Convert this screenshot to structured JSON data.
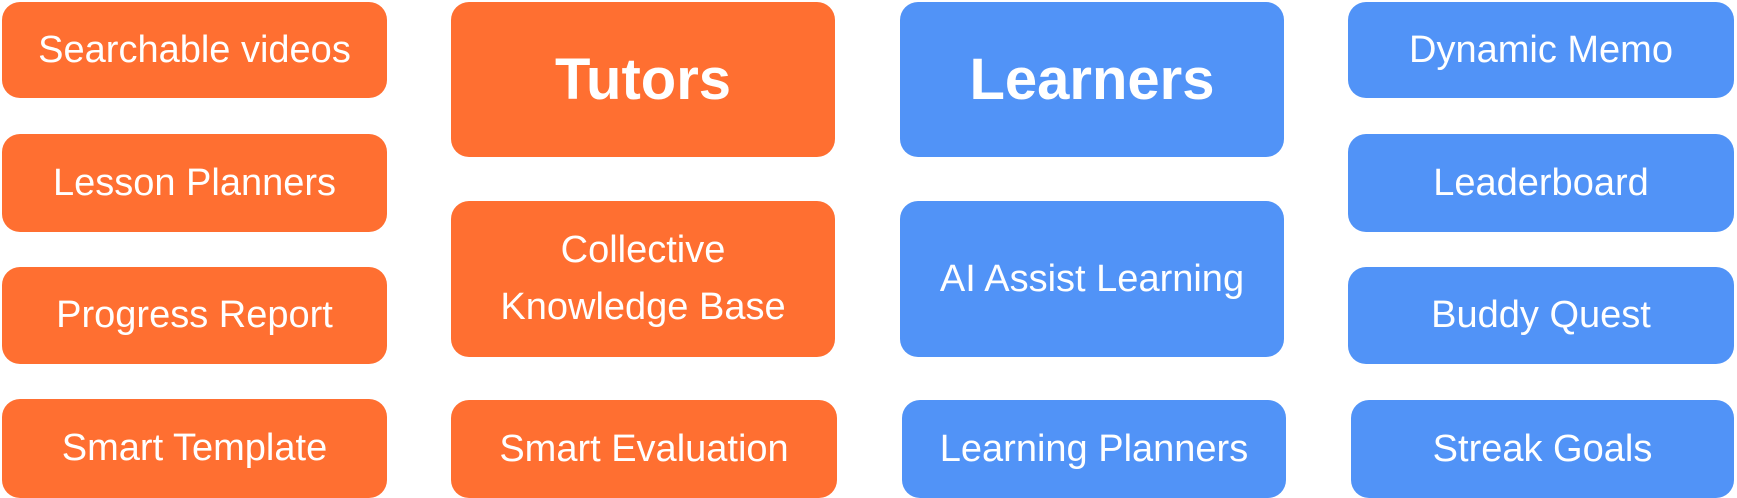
{
  "colors": {
    "tutor_accent": "#FF6F31",
    "learner_accent": "#5193F7",
    "text": "#FFFFFF"
  },
  "tutors": {
    "header": "Tutors",
    "features_left": [
      "Searchable videos",
      "Lesson Planners",
      "Progress Report",
      "Smart Template"
    ],
    "features_center": [
      "Collective\nKnowledge Base",
      "Smart Evaluation"
    ]
  },
  "learners": {
    "header": "Learners",
    "features_center": [
      "AI Assist Learning",
      "Learning Planners"
    ],
    "features_right": [
      "Dynamic Memo",
      "Leaderboard",
      "Buddy Quest",
      "Streak Goals"
    ]
  }
}
